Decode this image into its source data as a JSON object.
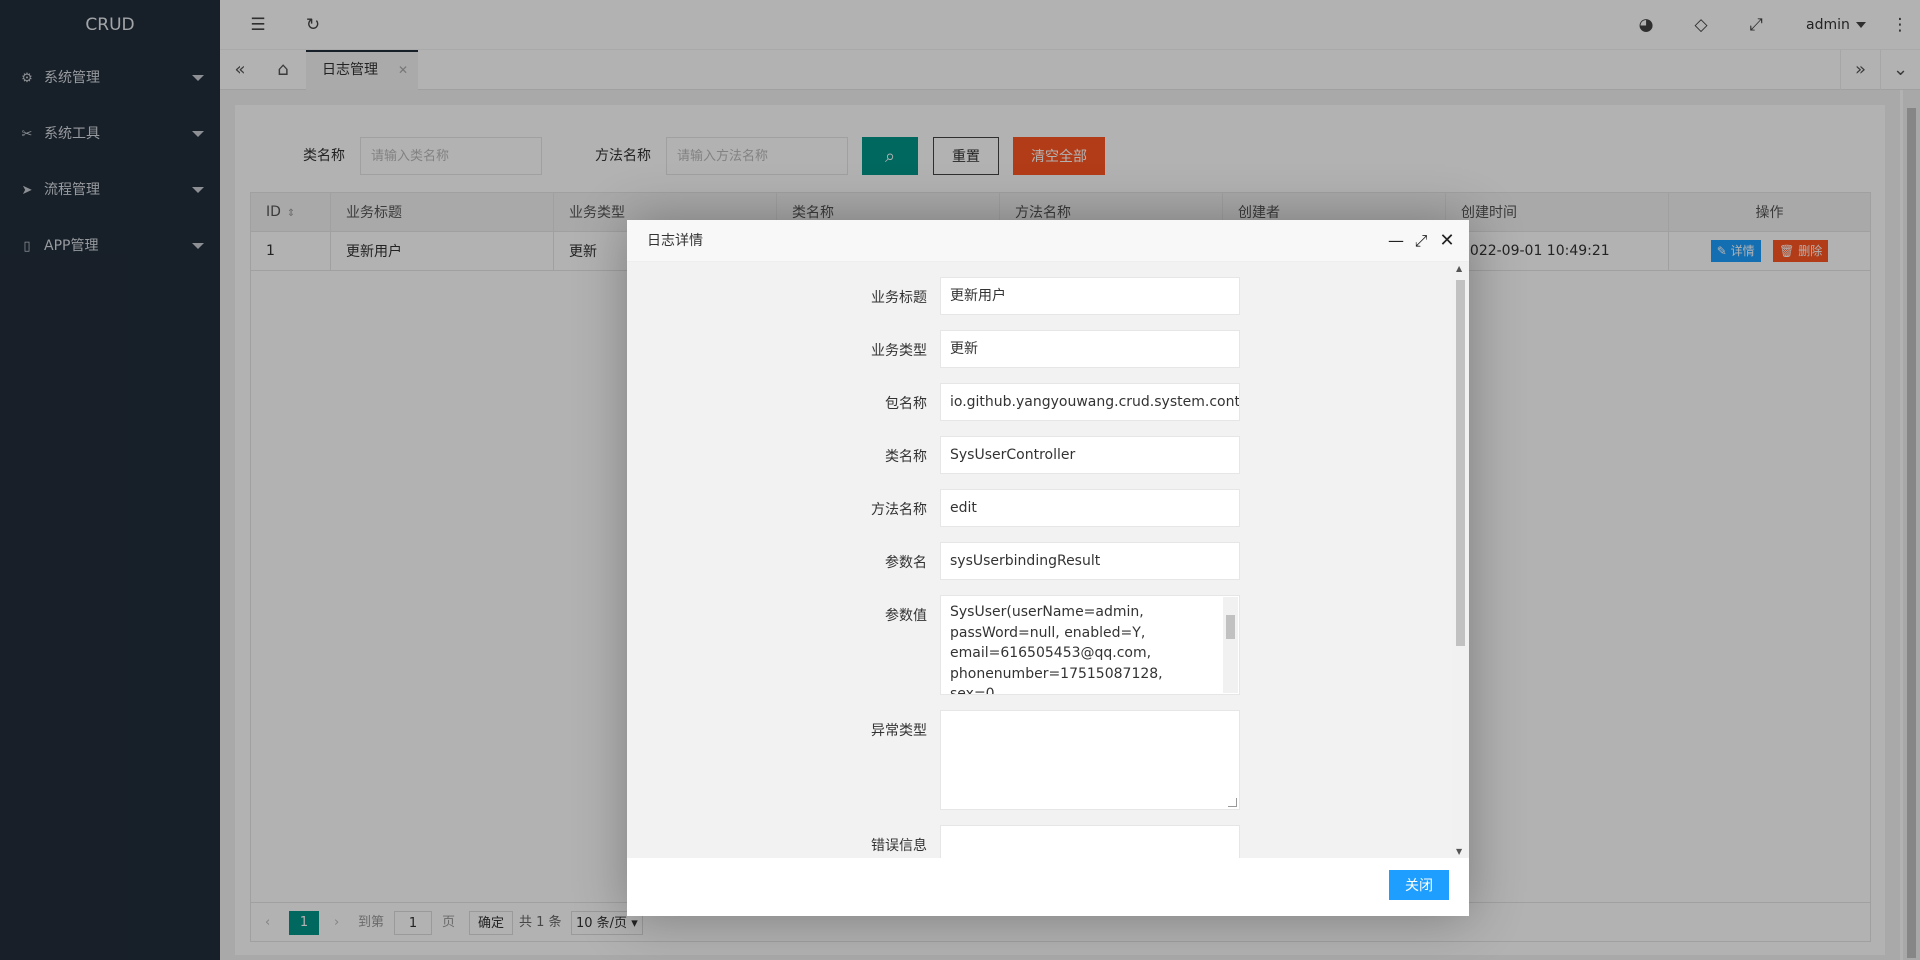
{
  "app": {
    "logo": "CRUD"
  },
  "sidebar": {
    "items": [
      {
        "label": "系统管理",
        "icon": "gear-icon"
      },
      {
        "label": "系统工具",
        "icon": "tools-icon"
      },
      {
        "label": "流程管理",
        "icon": "send-icon"
      },
      {
        "label": "APP管理",
        "icon": "mobile-icon"
      }
    ]
  },
  "header": {
    "user": "admin"
  },
  "tabs": {
    "active": "日志管理"
  },
  "search": {
    "class_label": "类名称",
    "class_placeholder": "请输入类名称",
    "method_label": "方法名称",
    "method_placeholder": "请输入方法名称",
    "reset_label": "重置",
    "clear_label": "清空全部"
  },
  "table": {
    "columns": [
      "ID",
      "业务标题",
      "业务类型",
      "类名称",
      "方法名称",
      "创建者",
      "创建时间",
      "操作"
    ],
    "rows": [
      {
        "id": "1",
        "title": "更新用户",
        "type": "更新",
        "created": "2022-09-01 10:49:21"
      }
    ],
    "actions": {
      "edit": "详情",
      "delete": "删除"
    }
  },
  "pager": {
    "current": "1",
    "goto_label": "到第",
    "page_input": "1",
    "page_label": "页",
    "confirm": "确定",
    "total": "共 1 条",
    "size": "10 条/页"
  },
  "dialog": {
    "title": "日志详情",
    "fields": {
      "title_label": "业务标题",
      "title_value": "更新用户",
      "type_label": "业务类型",
      "type_value": "更新",
      "package_label": "包名称",
      "package_value": "io.github.yangyouwang.crud.system.controller.",
      "class_label": "类名称",
      "class_value": "SysUserController",
      "method_label": "方法名称",
      "method_value": "edit",
      "param_name_label": "参数名",
      "param_name_value": "sysUserbindingResult",
      "param_value_label": "参数值",
      "param_value": "SysUser(userName=admin, passWord=null, enabled=Y, email=616505453@qq.com, phonenumber=17515087128, sex=0, avatar=https://www.baidu.com/img/PCtm",
      "exception_label": "异常类型",
      "exception_value": "",
      "error_label": "错误信息",
      "error_value": ""
    },
    "close_label": "关闭"
  },
  "colors": {
    "sidebar": "#222d3a",
    "teal": "#009688",
    "orange": "#ff5722",
    "blue": "#1e9fff"
  }
}
